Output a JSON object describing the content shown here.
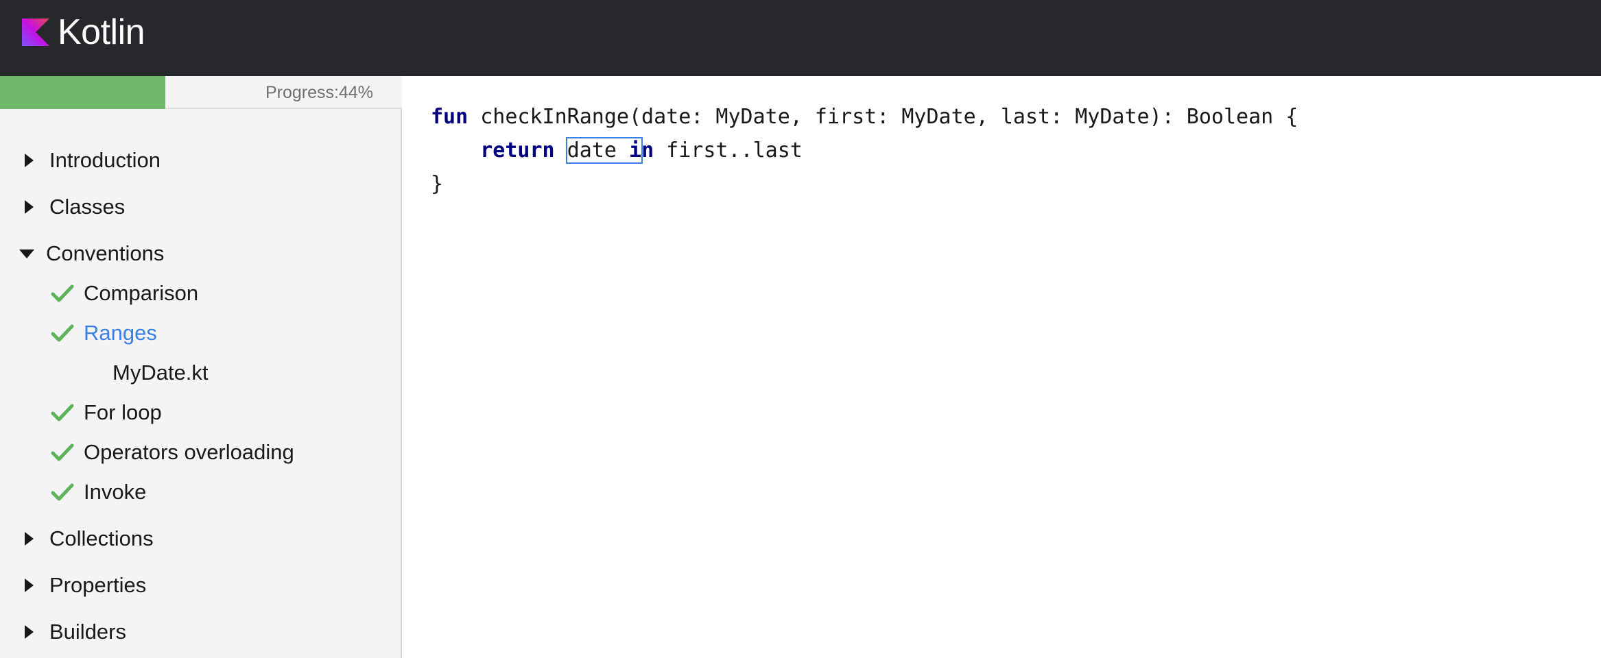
{
  "header": {
    "brand": "Kotlin",
    "logo_icon": "kotlin-logo-icon",
    "background": "#27282c"
  },
  "progress": {
    "label": "Progress:44%",
    "value_percent": 44,
    "fill_color": "#6fb86b"
  },
  "sidebar": {
    "items": [
      {
        "label": "Introduction",
        "state": "collapsed"
      },
      {
        "label": "Classes",
        "state": "collapsed"
      },
      {
        "label": "Conventions",
        "state": "expanded"
      },
      {
        "label": "Comparison",
        "state": "completed"
      },
      {
        "label": "Ranges",
        "state": "completed-selected"
      },
      {
        "label": "MyDate.kt",
        "state": "file"
      },
      {
        "label": "For loop",
        "state": "completed"
      },
      {
        "label": "Operators overloading",
        "state": "completed"
      },
      {
        "label": "Invoke",
        "state": "completed"
      },
      {
        "label": "Collections",
        "state": "collapsed"
      },
      {
        "label": "Properties",
        "state": "collapsed"
      },
      {
        "label": "Builders",
        "state": "collapsed"
      }
    ],
    "selected_color": "#3a7fe6",
    "check_color": "#5fb35b"
  },
  "editor": {
    "line1": {
      "kw": "fun",
      "rest": " checkInRange(date: MyDate, first: MyDate, last: MyDate): Boolean {"
    },
    "line2": {
      "indent": "    ",
      "kw": "return",
      "sp": " ",
      "sel_a": "date ",
      "sel_kw_a": "i",
      "kw_tail": "n",
      "rest": " first..last"
    },
    "line3": "}",
    "keyword_color": "#000080"
  }
}
